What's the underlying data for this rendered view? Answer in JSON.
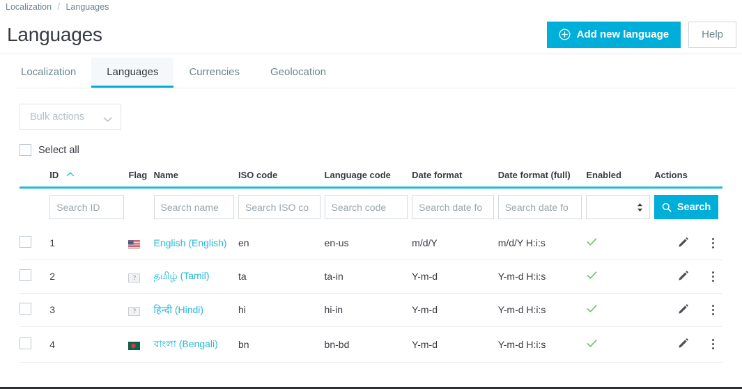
{
  "breadcrumb": {
    "parent": "Localization",
    "separator": "/",
    "current": "Languages"
  },
  "header": {
    "title": "Languages",
    "add_button_label": "Add new language",
    "help_button_label": "Help",
    "accent_color": "#00aeda"
  },
  "tabs": [
    {
      "label": "Localization",
      "active": false
    },
    {
      "label": "Languages",
      "active": true
    },
    {
      "label": "Currencies",
      "active": false
    },
    {
      "label": "Geolocation",
      "active": false
    }
  ],
  "toolbar": {
    "bulk_actions_label": "Bulk actions",
    "bulk_actions_disabled": true,
    "select_all_label": "Select all"
  },
  "table": {
    "columns": [
      {
        "key": "checkbox",
        "label": ""
      },
      {
        "key": "id",
        "label": "ID",
        "sorted": "asc"
      },
      {
        "key": "flag",
        "label": "Flag"
      },
      {
        "key": "name",
        "label": "Name"
      },
      {
        "key": "iso_code",
        "label": "ISO code"
      },
      {
        "key": "language_code",
        "label": "Language code"
      },
      {
        "key": "date_format",
        "label": "Date format"
      },
      {
        "key": "date_format_full",
        "label": "Date format (full)"
      },
      {
        "key": "enabled",
        "label": "Enabled"
      },
      {
        "key": "actions",
        "label": "Actions"
      }
    ],
    "filters": {
      "id_placeholder": "Search ID",
      "name_placeholder": "Search name",
      "iso_placeholder": "Search ISO co",
      "code_placeholder": "Search code",
      "date_placeholder": "Search date fo",
      "date_full_placeholder": "Search date fo",
      "enabled_value": "",
      "search_button_label": "Search"
    },
    "rows": [
      {
        "id": "1",
        "flag": "us-flag-icon",
        "name": "English (English)",
        "iso_code": "en",
        "language_code": "en-us",
        "date_format": "m/d/Y",
        "date_format_full": "m/d/Y H:i:s",
        "enabled": true
      },
      {
        "id": "2",
        "flag": "broken-image-icon",
        "name": "தமிழ் (Tamil)",
        "iso_code": "ta",
        "language_code": "ta-in",
        "date_format": "Y-m-d",
        "date_format_full": "Y-m-d H:i:s",
        "enabled": true
      },
      {
        "id": "3",
        "flag": "broken-image-icon",
        "name": "हिन्दी (Hindi)",
        "iso_code": "hi",
        "language_code": "hi-in",
        "date_format": "Y-m-d",
        "date_format_full": "Y-m-d H:i:s",
        "enabled": true
      },
      {
        "id": "4",
        "flag": "bangladesh-flag-icon",
        "name": "বাংলা (Bengali)",
        "iso_code": "bn",
        "language_code": "bn-bd",
        "date_format": "Y-m-d",
        "date_format_full": "Y-m-d H:i:s",
        "enabled": true
      }
    ]
  },
  "colors": {
    "accent": "#00aeda",
    "link": "#25b9d7",
    "enabled_check": "#6cc66c",
    "text": "#363a41",
    "muted": "#6c868e"
  }
}
